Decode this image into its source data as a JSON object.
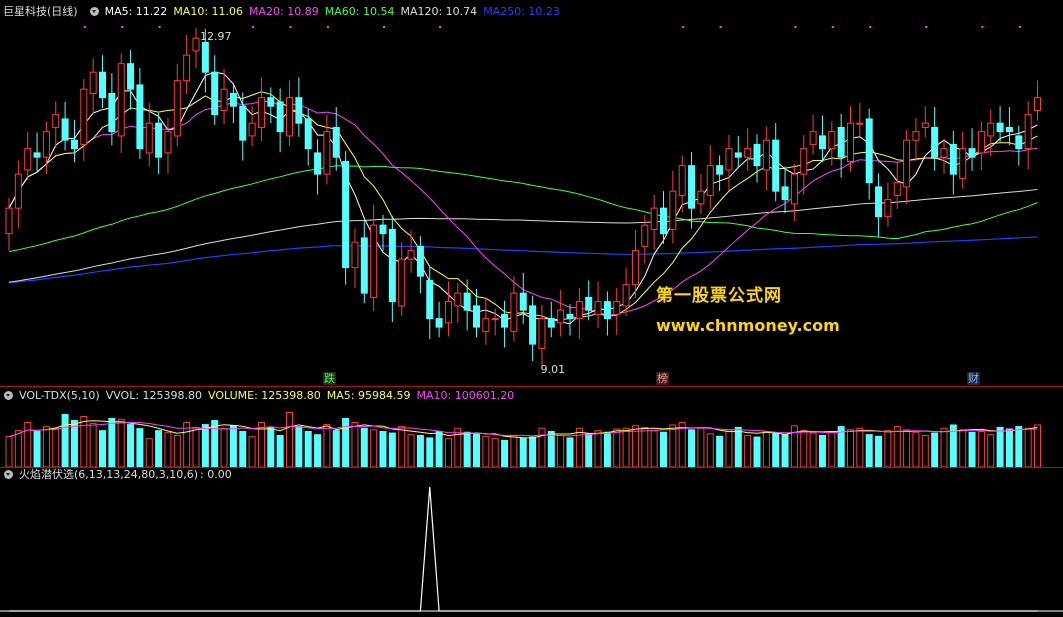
{
  "header": {
    "title": "巨星科技(日线)",
    "indicators": [
      {
        "label": "MA5: 11.22",
        "color": "#ffffff"
      },
      {
        "label": "MA10: 11.06",
        "color": "#ffff40"
      },
      {
        "label": "MA20: 10.89",
        "color": "#ff40ff"
      },
      {
        "label": "MA60: 10.54",
        "color": "#40ff40"
      },
      {
        "label": "MA120: 10.74",
        "color": "#dddddd"
      },
      {
        "label": "MA250: 10.23",
        "color": "#2040ff"
      }
    ]
  },
  "price_annotations": {
    "high": "12.97",
    "low": "9.01"
  },
  "watermark": {
    "line1": "第一股票公式网",
    "line2": "www.chnmoney.com"
  },
  "events": [
    {
      "label": "跌",
      "color": "#40ff40"
    },
    {
      "label": "榜",
      "color": "#ff9090"
    },
    {
      "label": "财",
      "color": "#7fb0ff"
    }
  ],
  "volume_header": {
    "name": "VOL-TDX(5,10)",
    "vvol": "VVOL: 125398.80",
    "volume": "VOLUME: 125398.80",
    "ma5": "MA5: 95984.59",
    "ma10": "MA10: 100601.20"
  },
  "signal_header": {
    "name": "火焰潜伏选(6,13,13,24,80,3,10,6)",
    "value": ": 0.00"
  },
  "chart_data": {
    "type": "candlestick",
    "price_range": [
      9.01,
      12.97
    ],
    "closes": [
      10.9,
      11.3,
      11.6,
      11.5,
      11.8,
      12.0,
      11.7,
      11.6,
      12.3,
      12.5,
      12.2,
      11.8,
      12.6,
      12.3,
      11.6,
      11.9,
      11.5,
      11.8,
      12.4,
      12.7,
      12.9,
      12.5,
      12.0,
      12.3,
      12.1,
      11.7,
      11.9,
      12.2,
      12.1,
      11.8,
      12.2,
      11.9,
      11.6,
      11.3,
      11.8,
      11.5,
      10.2,
      10.5,
      9.9,
      10.7,
      10.6,
      9.8,
      10.3,
      10.4,
      10.1,
      9.6,
      9.5,
      9.8,
      9.9,
      9.7,
      9.5,
      9.6,
      9.6,
      9.5,
      9.9,
      9.7,
      9.3,
      9.6,
      9.5,
      9.7,
      9.6,
      9.8,
      9.7,
      9.8,
      9.6,
      9.8,
      10.0,
      10.4,
      10.7,
      10.9,
      10.6,
      11.1,
      11.4,
      10.9,
      11.1,
      11.4,
      11.3,
      11.6,
      11.5,
      11.6,
      11.4,
      11.7,
      11.1,
      11.0,
      11.3,
      11.6,
      11.8,
      11.6,
      11.8,
      11.5,
      11.9,
      11.9,
      11.2,
      10.8,
      11.0,
      11.2,
      11.7,
      11.8,
      11.9,
      11.5,
      11.6,
      11.3,
      11.6,
      11.5,
      11.8,
      11.9,
      11.8,
      11.8,
      11.6,
      12.0,
      12.2
    ],
    "volumes": [
      75,
      90,
      110,
      88,
      100,
      95,
      130,
      115,
      125,
      108,
      90,
      120,
      118,
      105,
      95,
      70,
      90,
      85,
      78,
      110,
      98,
      105,
      115,
      95,
      102,
      88,
      75,
      110,
      98,
      78,
      135,
      100,
      88,
      80,
      105,
      90,
      120,
      110,
      96,
      92,
      88,
      84,
      100,
      80,
      78,
      72,
      88,
      70,
      96,
      86,
      82,
      76,
      70,
      66,
      78,
      72,
      74,
      96,
      88,
      78,
      72,
      96,
      82,
      90,
      86,
      94,
      96,
      102,
      98,
      90,
      86,
      104,
      110,
      92,
      96,
      82,
      76,
      92,
      98,
      78,
      74,
      88,
      84,
      80,
      102,
      90,
      84,
      78,
      86,
      100,
      92,
      96,
      80,
      76,
      90,
      100,
      92,
      86,
      78,
      84,
      96,
      104,
      92,
      86,
      88,
      80,
      98,
      94,
      100,
      96,
      104
    ],
    "signal": {
      "peak_bar_index": 45,
      "value_at_peak": 1,
      "current_value": 0.0
    }
  }
}
